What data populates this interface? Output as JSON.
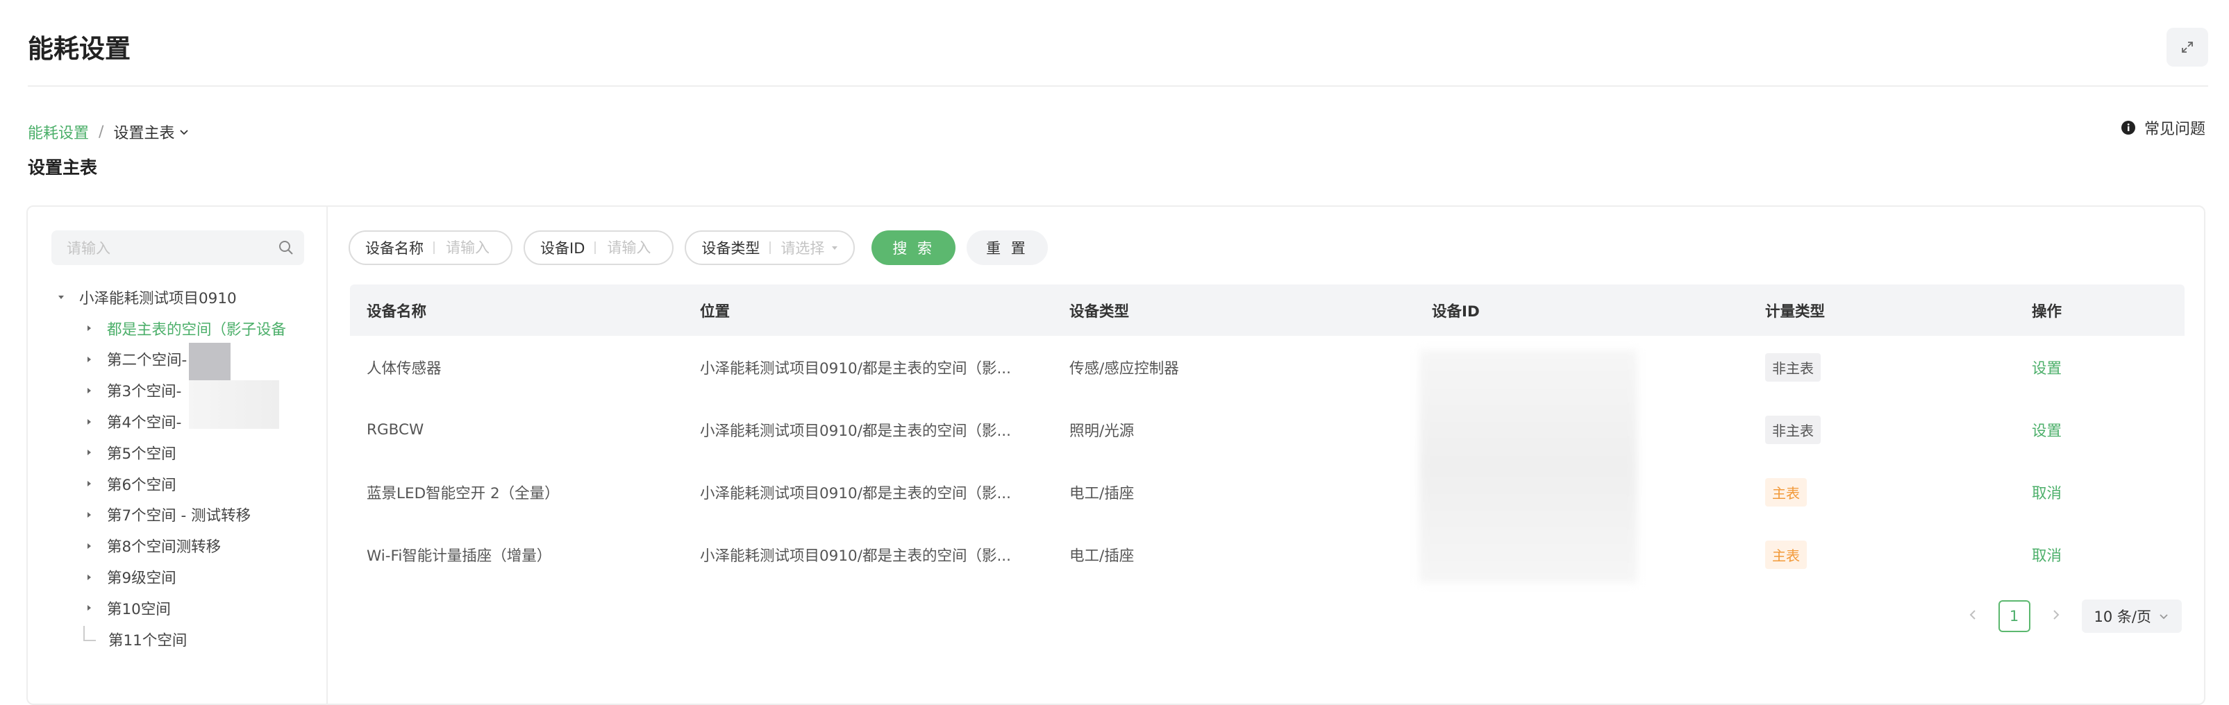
{
  "header": {
    "title": "能耗设置"
  },
  "breadcrumb": {
    "root": "能耗设置",
    "separator": "/",
    "current": "设置主表"
  },
  "faq": {
    "label": "常见问题"
  },
  "section": {
    "title": "设置主表"
  },
  "sidebar": {
    "search_placeholder": "请输入",
    "root_label": "小泽能耗测试项目0910",
    "items": [
      {
        "label": "都是主表的空间（影子设备",
        "active": true
      },
      {
        "label": "第二个空间-"
      },
      {
        "label": "第3个空间-"
      },
      {
        "label": "第4个空间-"
      },
      {
        "label": "第5个空间"
      },
      {
        "label": "第6个空间"
      },
      {
        "label": "第7个空间 - 测试转移"
      },
      {
        "label": "第8个空间测转移"
      },
      {
        "label": "第9级空间"
      },
      {
        "label": "第10空间"
      },
      {
        "label": "第11个空间"
      }
    ]
  },
  "filters": {
    "device_name": {
      "label": "设备名称",
      "placeholder": "请输入"
    },
    "device_id": {
      "label": "设备ID",
      "placeholder": "请输入"
    },
    "device_type": {
      "label": "设备类型",
      "placeholder": "请选择"
    },
    "search_label": "搜 索",
    "reset_label": "重 置"
  },
  "table": {
    "headers": [
      "设备名称",
      "位置",
      "设备类型",
      "设备ID",
      "计量类型",
      "操作"
    ],
    "rows": [
      {
        "name": "人体传感器",
        "location": "小泽能耗测试项目0910/都是主表的空间（影...",
        "type": "传感/感应控制器",
        "meter": "非主表",
        "action": "设置"
      },
      {
        "name": "RGBCW",
        "location": "小泽能耗测试项目0910/都是主表的空间（影...",
        "type": "照明/光源",
        "meter": "非主表",
        "action": "设置"
      },
      {
        "name": "蓝景LED智能空开 2（全量）",
        "location": "小泽能耗测试项目0910/都是主表的空间（影...",
        "type": "电工/插座",
        "meter": "主表",
        "action": "取消"
      },
      {
        "name": "Wi-Fi智能计量插座（增量）",
        "location": "小泽能耗测试项目0910/都是主表的空间（影...",
        "type": "电工/插座",
        "meter": "主表",
        "action": "取消"
      }
    ]
  },
  "pagination": {
    "current_page": "1",
    "page_size": "10 条/页"
  },
  "colors": {
    "accent": "#4caf6a",
    "orange": "#f29a3a"
  }
}
